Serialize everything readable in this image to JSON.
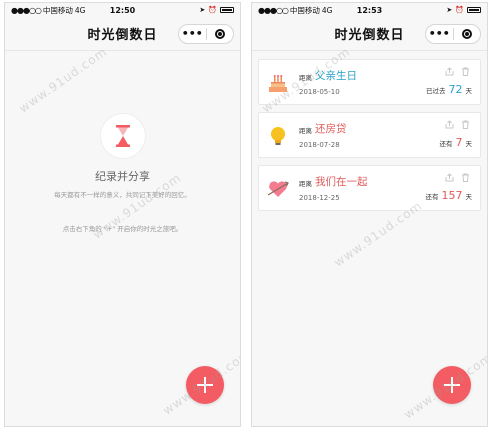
{
  "status_bar": {
    "signal": "●●●○○",
    "carrier": "中国移动",
    "network": "4G",
    "left_time": "12:50",
    "right_time": "12:53"
  },
  "nav": {
    "title": "时光倒数日",
    "more_glyph": "•••"
  },
  "empty_state": {
    "title": "纪录并分享",
    "description": "每天都有不一样的意义，共同记下美好的回忆。",
    "hint": "点击右下角的 \"+\" 开启你的时光之旅吧。"
  },
  "events": [
    {
      "icon": "cake-icon",
      "prefix": "距离",
      "name": "父亲生日",
      "date": "2018-05-10",
      "count_label": "已过去",
      "count": "72",
      "unit": "天",
      "color": "#2aa1c7",
      "count_color": "#2aa1c7"
    },
    {
      "icon": "lightbulb-icon",
      "prefix": "距离",
      "name": "还房贷",
      "date": "2018-07-28",
      "count_label": "还有",
      "count": "7",
      "unit": "天",
      "color": "#e15a5a",
      "count_color": "#e15a5a"
    },
    {
      "icon": "heart-icon",
      "prefix": "距离",
      "name": "我们在一起",
      "date": "2018-12-25",
      "count_label": "还有",
      "count": "157",
      "unit": "天",
      "color": "#e15a5a",
      "count_color": "#e15a5a"
    }
  ],
  "watermark": "www.91ud.com",
  "colors": {
    "accent": "#f25c62",
    "blue": "#2aa1c7",
    "red": "#e15a5a"
  }
}
